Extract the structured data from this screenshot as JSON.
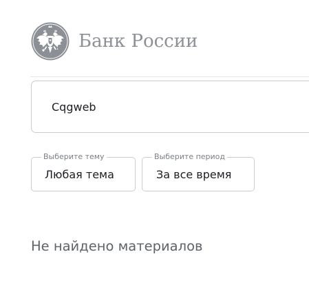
{
  "header": {
    "emblem_icon": "double-headed-eagle-emblem",
    "brand_name": "Банк России",
    "brand_color": "#8c9096"
  },
  "search": {
    "value": "Cqgweb"
  },
  "filters": {
    "topic": {
      "legend": "Выберите тему",
      "selected": "Любая тема"
    },
    "period": {
      "legend": "Выберите период",
      "selected": "За все время"
    }
  },
  "results": {
    "empty_message": "Не найдено материалов"
  }
}
